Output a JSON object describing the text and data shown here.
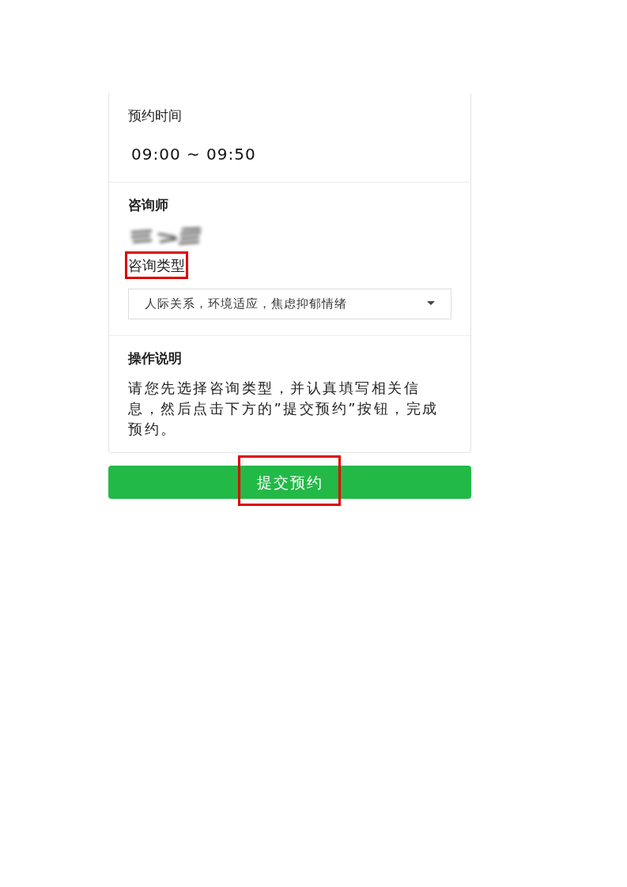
{
  "sections": [
    {
      "kind": "time",
      "label": "预约时间",
      "value": "09:00 ~ 09:50"
    },
    {
      "kind": "counselor",
      "label": "咨询师",
      "name_redacted": true,
      "type_label": "咨询类型",
      "type_label_marked": true,
      "type_value": "人际关系，环境适应，焦虑抑郁情绪"
    },
    {
      "kind": "note",
      "label": "操作说明",
      "text": "请您先选择咨询类型，并认真填写相关信息，然后点击下方的”提交预约”按钮，完成预约。"
    }
  ],
  "submit_button": {
    "label": "提交预约",
    "marked": true
  }
}
